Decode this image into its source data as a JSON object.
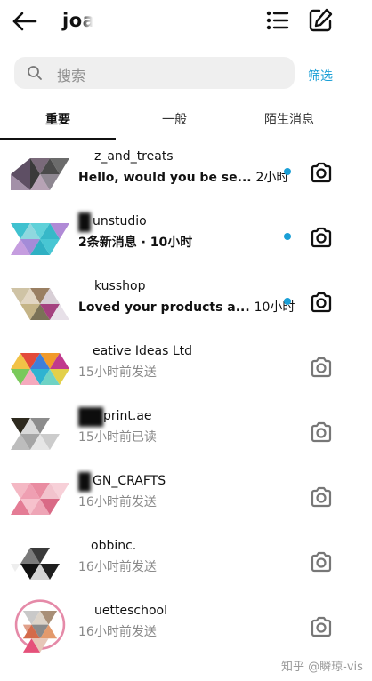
{
  "header": {
    "title": "joa",
    "back_icon": "back-arrow-icon",
    "list_icon": "list-icon",
    "compose_icon": "compose-icon"
  },
  "search": {
    "placeholder": "搜索",
    "filter_label": "筛选"
  },
  "tabs": [
    {
      "label": "重要",
      "active": true
    },
    {
      "label": "一般"
    },
    {
      "label": "陌生消息"
    }
  ],
  "conversations": [
    {
      "name": "z_and_treats",
      "preview": "Hello, would you be se...",
      "time": "2小时",
      "unread": true
    },
    {
      "name": "unstudio",
      "preview": "2条新消息 · 10小时",
      "time": "",
      "unread": true
    },
    {
      "name": "kusshop",
      "preview": "Loved your products a...",
      "time": "10小时",
      "unread": true
    },
    {
      "name": "eative Ideas Ltd",
      "preview": "15小时前发送",
      "time": "",
      "unread": false
    },
    {
      "name": "print.ae",
      "preview": "15小时前已读",
      "time": "",
      "unread": false
    },
    {
      "name": "GN_CRAFTS",
      "preview": "16小时前发送",
      "time": "",
      "unread": false
    },
    {
      "name": "obbinc.",
      "preview": "16小时前发送",
      "time": "",
      "unread": false
    },
    {
      "name": "uetteschool",
      "preview": "16小时前发送",
      "time": "",
      "unread": false
    }
  ],
  "watermark": "知乎 @瞬琼-vis",
  "colors": {
    "accent": "#1a9fd6",
    "unread_dot": "#1a9fd6"
  }
}
